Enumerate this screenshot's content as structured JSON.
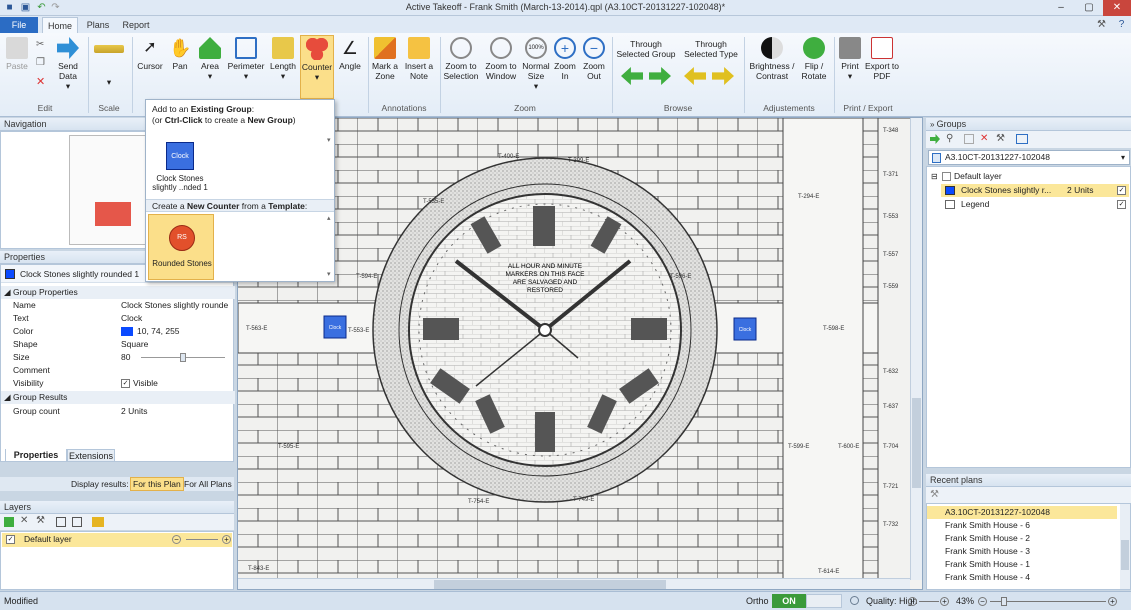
{
  "window": {
    "title": "Active Takeoff - Frank Smith (March-13-2014).qpl (A3.10CT-20131227-102048)*"
  },
  "tabs": {
    "file": "File",
    "home": "Home",
    "plans": "Plans",
    "report": "Report"
  },
  "ribbon": {
    "paste": "Paste",
    "send_data": "Send Data",
    "cursor": "Cursor",
    "pan": "Pan",
    "area": "Area",
    "perimeter": "Perimeter",
    "length": "Length",
    "counter": "Counter",
    "angle": "Angle",
    "mark_zone": "Mark a Zone",
    "insert_note": "Insert a Note",
    "zoom_selection": "Zoom to Selection",
    "zoom_window": "Zoom to Window",
    "normal_size": "Normal Size",
    "zoom_in": "Zoom In",
    "zoom_out": "Zoom Out",
    "through_group": "Through Selected Group",
    "through_type": "Through Selected Type",
    "brightness": "Brightness / Contrast",
    "flip": "Flip / Rotate",
    "print": "Print",
    "export": "Export to PDF",
    "groups": {
      "edit": "Edit",
      "scale": "Scale",
      "annotations": "Annotations",
      "zoom": "Zoom",
      "browse": "Browse",
      "adjustments": "Adjustements",
      "print_export": "Print / Export"
    }
  },
  "popup": {
    "line1": "Add to an ",
    "line1b": "Existing Group",
    "line2": "(or ",
    "line2b": "Ctrl-Click",
    " line2c": " to create a ",
    "line2d": "New Group",
    "existing_icon": "Clock",
    "existing_label1": "Clock Stones",
    "existing_label2": "slightly ..nded 1",
    "template_header_a": "Create a ",
    "template_header_b": "New Counter",
    "template_header_c": " from a ",
    "template_header_d": "Template",
    "template_icon": "RS",
    "template_label": "Rounded Stones"
  },
  "navigation": {
    "title": "Navigation"
  },
  "properties": {
    "title": "Properties",
    "selected": "Clock Stones slightly rounded 1",
    "section1": "Group Properties",
    "rows": [
      {
        "k": "Name",
        "v": "Clock Stones slightly rounde"
      },
      {
        "k": "Text",
        "v": "Clock"
      },
      {
        "k": "Color",
        "v": "10, 74, 255"
      },
      {
        "k": "Shape",
        "v": "Square"
      },
      {
        "k": "Size",
        "v": "80"
      },
      {
        "k": "Comment",
        "v": ""
      },
      {
        "k": "Visibility",
        "v": "Visible"
      }
    ],
    "section2": "Group Results",
    "count_k": "Group count",
    "count_v": "2 Units",
    "tab1": "Properties",
    "tab2": "Extensions",
    "display_label": "Display results:",
    "for_plan": "For this Plan",
    "for_all": "For All Plans",
    "color_hex": "#0a4aff"
  },
  "layers": {
    "title": "Layers",
    "default": "Default layer"
  },
  "groups_panel": {
    "title": "Groups",
    "plan": "A3.10CT-20131227-102048",
    "default_layer": "Default layer",
    "item": "Clock Stones slightly r...",
    "item_count": "2 Units",
    "legend": "Legend"
  },
  "recent": {
    "title": "Recent plans",
    "items": [
      "A3.10CT-20131227-102048",
      "Frank Smith House - 6",
      "Frank Smith House - 2",
      "Frank Smith House - 3",
      "Frank Smith House - 1",
      "Frank Smith House - 4"
    ]
  },
  "drawing": {
    "center_text": [
      "ALL HOUR AND MINUTE",
      "MARKERS ON THIS FACE",
      "ARE SALVAGED AND",
      "RESTORED"
    ],
    "labels": [
      "T-400-E",
      "T-399-E",
      "T-535-E",
      "T-598-E",
      "T-563-E",
      "T-553-E",
      "T-596-E",
      "T-594-E",
      "T-595-E",
      "T-599-E",
      "T-600-E",
      "T-754-E",
      "T-749-E",
      "T-843-E",
      "T-614-E",
      "T-294-E",
      "T-348",
      "T-371",
      "T-553",
      "T-557",
      "T-559",
      "T-632",
      "T-637",
      "T-704",
      "T-721",
      "T-732"
    ],
    "marker": "Clock"
  },
  "status": {
    "left": "Modified",
    "ortho": "Ortho",
    "on": "ON",
    "quality": "Quality: High",
    "zoom": "43%"
  }
}
